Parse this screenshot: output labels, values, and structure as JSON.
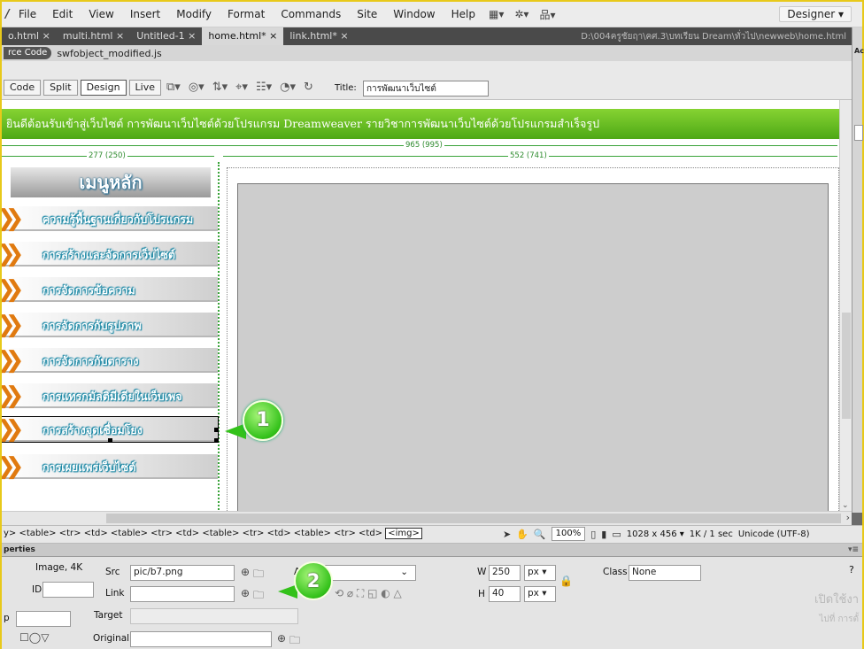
{
  "menubar": {
    "items": [
      "File",
      "Edit",
      "View",
      "Insert",
      "Modify",
      "Format",
      "Commands",
      "Site",
      "Window",
      "Help"
    ],
    "workspace": "Designer ▾"
  },
  "tabs": {
    "items": [
      "o.html ×",
      "multi.html ×",
      "Untitled-1 ×",
      "home.html* ×",
      "link.html* ×"
    ],
    "active_index": 3,
    "path": "D:\\004ครูชัยฤา\\คศ.3\\บทเรียน Dream\\ทั่วไป\\newweb\\home.html"
  },
  "related_files": {
    "source_code": "rce Code",
    "file": "swfobject_modified.js"
  },
  "doc_toolbar": {
    "views": [
      "Code",
      "Split",
      "Design",
      "Live"
    ],
    "active_view": "Design",
    "title_label": "Title:",
    "title_value": "การพัฒนาเว็บไซต์"
  },
  "right_panel": {
    "label": "Ac"
  },
  "page": {
    "banner": "ยินดีต้อนรับเข้าสู่เว็บไซต์ การพัฒนาเว็บไซต์ด้วยโปรแกรม Dreamweaver รายวิชาการพัฒนาเว็บไซต์ด้วยโปรแกรมสำเร็จรูป",
    "width_total": "965 (995)",
    "width_left": "277 (250)",
    "width_right": "552 (741)",
    "menu_heading": "เมนูหลัก",
    "menu_items": [
      "ความรู้พื้นฐานเกี่ยวกับโปรแกรม",
      "การสร้างและจัดการเว็บไซต์",
      "การจัดการข้อความ",
      "การจัดการกับรูปภาพ",
      "การจัดการกับตาราง",
      "การแทรกมัลติมีเดียในเว็บเพจ",
      "การสร้างจุดเชื่อมโยง",
      "การเผยแพร่เว็บไซต์"
    ],
    "selected_index": 6,
    "accent": "#3aa33a",
    "chevron_color": "#e07a10"
  },
  "callouts": {
    "one": "1",
    "two": "2"
  },
  "status": {
    "tag_selector": "y> <table> <tr> <td> <table> <tr> <td> <table> <tr> <td> <table> <tr> <td>",
    "selected_tag": "<img>",
    "zoom": "100%",
    "window_size": "1028 x 456 ▾",
    "download": "1K / 1 sec",
    "encoding": "Unicode (UTF-8)"
  },
  "properties": {
    "header": "perties",
    "type": "Image, 4K",
    "id_label": "ID",
    "id_value": "",
    "src_label": "Src",
    "src_value": "pic/b7.png",
    "link_label": "Link",
    "link_value": "",
    "target_label": "Target",
    "target_value": "",
    "original_label": "Original",
    "original_value": "",
    "map_label": "p",
    "alt_partial": "A",
    "w_label": "W",
    "w_value": "250",
    "h_label": "H",
    "h_value": "40",
    "w_unit": "px ▾",
    "h_unit": "px ▾",
    "class_label": "Class",
    "class_value": "None",
    "help": "?",
    "watermark_line1": "เปิดใช้งา",
    "watermark_line2": "ไปที่ การตั้"
  }
}
